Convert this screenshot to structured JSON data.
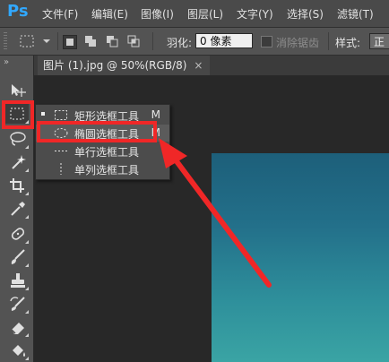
{
  "app": {
    "logo": "Ps",
    "accent": "#31a8ff"
  },
  "menu": [
    "文件(F)",
    "编辑(E)",
    "图像(I)",
    "图层(L)",
    "文字(Y)",
    "选择(S)",
    "滤镜(T)"
  ],
  "options": {
    "feather_label": "羽化:",
    "feather_value": "0 像素",
    "antialias_label": "消除锯齿",
    "antialias_checked": false,
    "style_label": "样式:",
    "style_value": "正"
  },
  "toolbar": {
    "collapse": "»",
    "tools": [
      "move-icon",
      "rectangular-marquee-icon",
      "lasso-icon",
      "magic-wand-icon",
      "crop-icon",
      "eyedropper-icon",
      "healing-brush-icon",
      "brush-icon",
      "clone-stamp-icon",
      "history-brush-icon",
      "eraser-icon",
      "paint-bucket-icon"
    ],
    "active_tool": "rectangular-marquee-icon"
  },
  "document": {
    "tab_title": "图片 (1).jpg @ 50%(RGB/8)",
    "close": "×"
  },
  "flyout": {
    "items": [
      {
        "label": "矩形选框工具",
        "shortcut": "M",
        "icon": "rect-marquee-icon",
        "current": true
      },
      {
        "label": "椭圆选框工具",
        "shortcut": "M",
        "icon": "elliptical-marquee-icon",
        "current": false
      },
      {
        "label": "单行选框工具",
        "shortcut": "",
        "icon": "single-row-marquee-icon",
        "current": false
      },
      {
        "label": "单列选框工具",
        "shortcut": "",
        "icon": "single-column-marquee-icon",
        "current": false
      }
    ]
  },
  "annotation": {
    "color": "#f02727"
  }
}
